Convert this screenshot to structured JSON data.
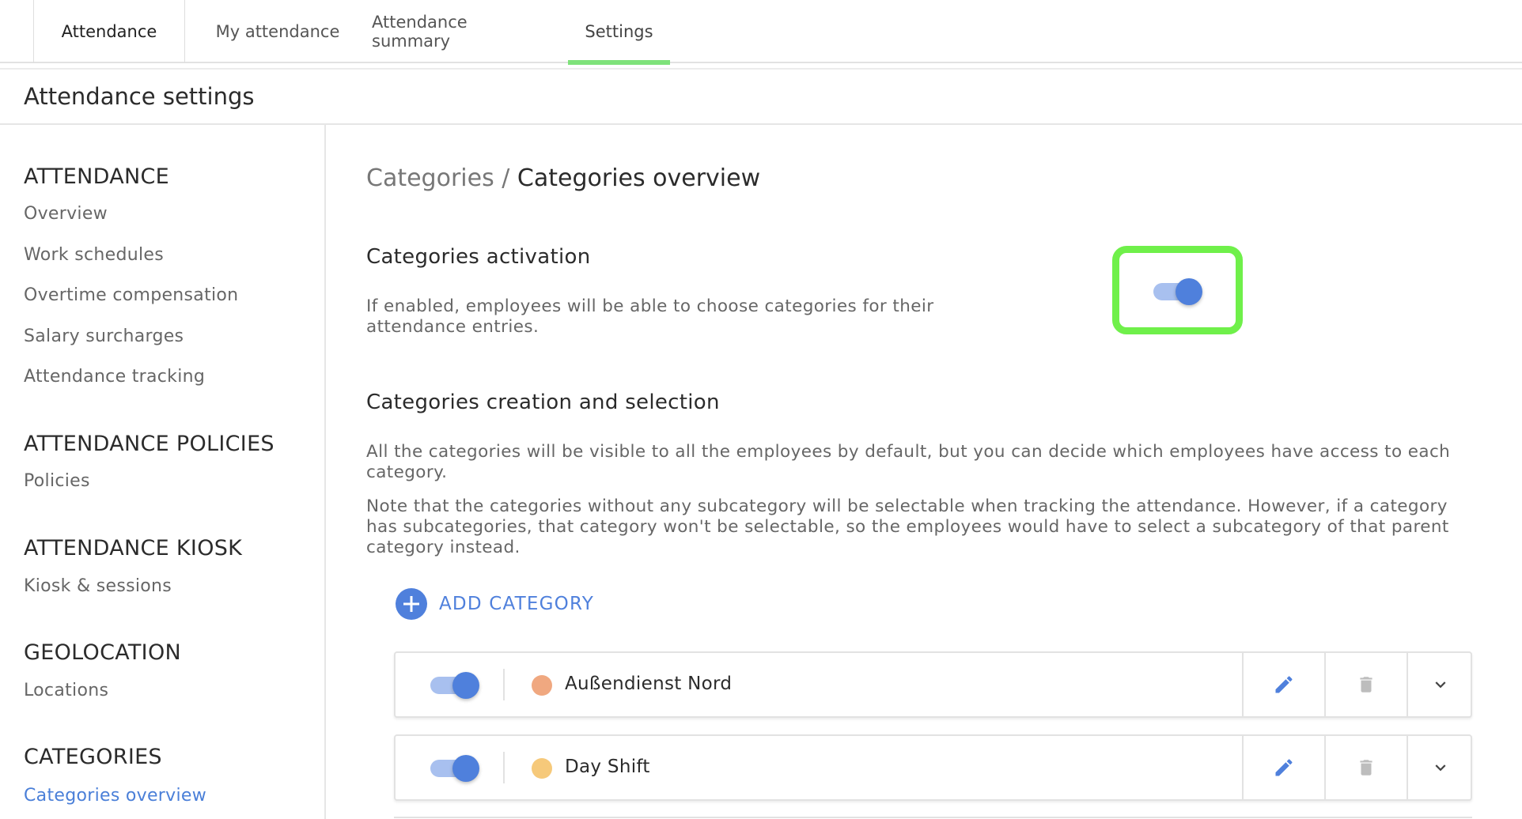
{
  "nav": {
    "app_tab": "Attendance",
    "tabs": [
      {
        "label": "My attendance"
      },
      {
        "label": "Attendance summary"
      },
      {
        "label": "Settings",
        "active": true
      }
    ]
  },
  "page_title": "Attendance settings",
  "sidebar": {
    "sections": [
      {
        "title": "ATTENDANCE",
        "items": [
          "Overview",
          "Work schedules",
          "Overtime compensation",
          "Salary surcharges",
          "Attendance tracking"
        ]
      },
      {
        "title": "ATTENDANCE POLICIES",
        "items": [
          "Policies"
        ]
      },
      {
        "title": "ATTENDANCE KIOSK",
        "items": [
          "Kiosk & sessions"
        ]
      },
      {
        "title": "GEOLOCATION",
        "items": [
          "Locations"
        ]
      },
      {
        "title": "CATEGORIES",
        "items": [
          "Categories overview"
        ]
      }
    ],
    "active_item": "Categories overview"
  },
  "main": {
    "breadcrumb_parent": "Categories /",
    "breadcrumb_current": "Categories overview",
    "activation": {
      "title": "Categories activation",
      "description_line1": "If enabled, employees will be able to choose categories for their",
      "description_line2": "attendance entries.",
      "enabled": true
    },
    "creation": {
      "title": "Categories creation and selection",
      "para1_line1": "All the categories will be visible to all the employees by default, but you can decide which employees have access to each",
      "para1_line2": "category.",
      "para2_line1": "Note that the categories without any subcategory will be selectable when tracking the attendance. However, if a category",
      "para2_line2": "has subcategories, that category won't be selectable, so the employees would have to select a subcategory of that parent",
      "para2_line3": "category instead."
    },
    "add_category_label": "ADD CATEGORY",
    "categories": [
      {
        "name": "Außendienst Nord",
        "color": "#f0a880",
        "enabled": true
      },
      {
        "name": "Day Shift",
        "color": "#f6c97a",
        "enabled": true
      }
    ]
  },
  "colors": {
    "accent": "#4f80dc",
    "active_tab_underline": "#7ee27a",
    "highlight_border": "#6ff04a"
  },
  "icons": {
    "edit": "pencil-icon",
    "delete": "trash-icon",
    "expand": "chevron-down-icon",
    "add": "plus-circle-icon"
  }
}
